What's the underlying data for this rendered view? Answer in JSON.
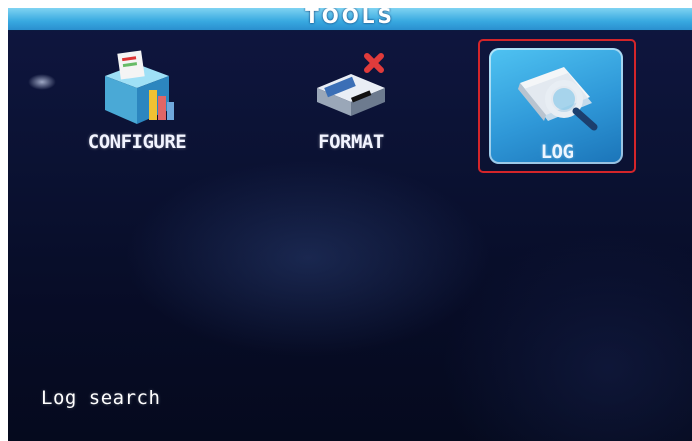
{
  "screen": {
    "title": "TOOLS"
  },
  "tools": [
    {
      "id": "configure",
      "label": "CONFIGURE",
      "icon": "configure-icon",
      "selected": false
    },
    {
      "id": "format",
      "label": "FORMAT",
      "icon": "format-icon",
      "selected": false
    },
    {
      "id": "log",
      "label": "LOG",
      "icon": "log-search-icon",
      "selected": true
    }
  ],
  "status": {
    "text": "Log search"
  },
  "colors": {
    "title_bar": "#38a9e0",
    "background": "#0b1233",
    "selection_border": "#d4252a",
    "selected_tile": "#2f98d8"
  }
}
